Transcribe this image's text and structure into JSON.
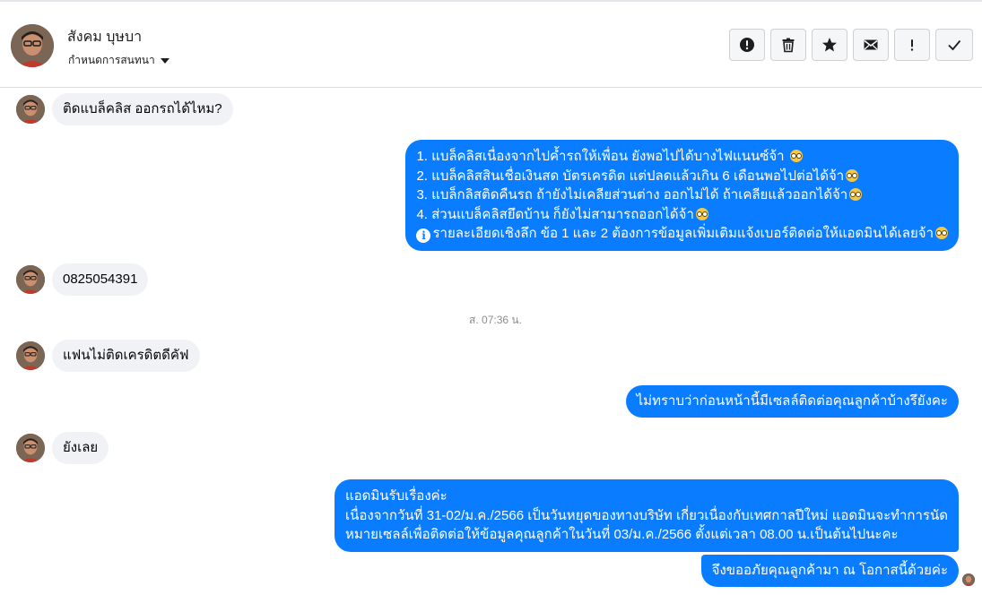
{
  "header": {
    "name": "สังคม บุษบา",
    "status": "กำหนดการสนทนา"
  },
  "toolbar": {
    "buttons": [
      {
        "name": "report-button",
        "icon": "alert-circle-icon"
      },
      {
        "name": "delete-button",
        "icon": "trash-icon"
      },
      {
        "name": "star-button",
        "icon": "star-icon"
      },
      {
        "name": "mark-unread-button",
        "icon": "envelope-icon"
      },
      {
        "name": "important-button",
        "icon": "exclamation-icon"
      },
      {
        "name": "done-button",
        "icon": "check-icon"
      }
    ]
  },
  "messages": {
    "m1": "ติดแบล็คลิส ออกรถได้ไหม?",
    "m2": {
      "l1": "1. แบล็คลิสเนื่องจากไปค้ำรถให้เพื่อน ยังพอไปได้บางไฟแนนซ์จ้า",
      "l2": "2. แบล็คลิสสินเชื่อเงินสด บัตรเครดิต แต่ปลดแล้วเกิน 6 เดือนพอไปต่อได้จ้า",
      "l3": "3. แบล็กลิสติดคืนรถ ถ้ายังไม่เคลียส่วนต่าง ออกไม่ได้ ถ้าเคลียแล้วออกได้จ้า",
      "l4": "4. ส่วนแบล็คลิสยึดบ้าน ก็ยังไม่สามารถออกได้จ้า",
      "l5": "รายละเอียดเชิงลึก ข้อ 1 และ 2 ต้องการข้อมูลเพิ่มเติมแจ้งเบอร์ติดต่อให้แอดมินได้เลยจ้า"
    },
    "m3": "0825054391",
    "timestamp": "ส. 07:36 น.",
    "m4": "แฟนไม่ติดเครดิตดีคัฟ",
    "m5": "ไม่ทราบว่าก่อนหน้านี้มีเซลล์ติดต่อคุณลูกค้าบ้างรึยังคะ",
    "m6": "ยังเลย",
    "m7": {
      "l1": "แอดมินรับเรื่องค่ะ",
      "l2": "เนื่องจากวันที่ 31-02/ม.ค./2566 เป็นวันหยุดของทางบริษัท เกี่ยวเนื่องกับเทศกาลปีใหม่ แอดมินจะทำการนัด",
      "l3": "หมายเซลล์เพื่อติดต่อให้ข้อมูลคุณลูกค้าในวันที่ 03/ม.ค./2566 ตั้งแต่เวลา 08.00 น.เป็นต้นไปนะคะ"
    },
    "m8": "จึงขออภัยคุณลูกค้ามา ณ โอกาสนี้ด้วยค่ะ"
  },
  "colors": {
    "outgoing_bubble": "#0a7cff",
    "incoming_bubble": "#f0f2f5",
    "timestamp": "#8a8d91"
  }
}
